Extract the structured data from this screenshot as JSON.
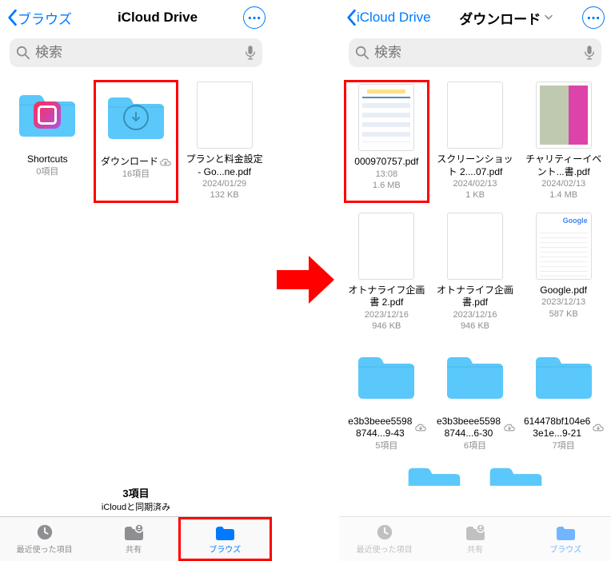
{
  "left": {
    "back_label": "ブラウズ",
    "title": "iCloud Drive",
    "search_placeholder": "検索",
    "items": [
      {
        "name": "Shortcuts",
        "meta1": "0項目",
        "meta2": "",
        "type": "shortcuts"
      },
      {
        "name": "ダウンロード",
        "meta1": "16項目",
        "meta2": "",
        "type": "download",
        "cloud": true,
        "highlight": true
      },
      {
        "name": "プランと料金設定 - Go...ne.pdf",
        "meta1": "2024/01/29",
        "meta2": "132 KB",
        "type": "doc"
      }
    ],
    "footer_count": "3項目",
    "footer_sync": "iCloudと同期済み"
  },
  "right": {
    "back_label": "iCloud Drive",
    "title": "ダウンロード",
    "search_placeholder": "検索",
    "items": [
      {
        "name": "000970757.pdf",
        "meta1": "13:08",
        "meta2": "1.6 MB",
        "type": "table",
        "highlight": true
      },
      {
        "name": "スクリーンショット 2....07.pdf",
        "meta1": "2024/02/13",
        "meta2": "1 KB",
        "type": "blank"
      },
      {
        "name": "チャリティーイベント...書.pdf",
        "meta1": "2024/02/13",
        "meta2": "1.4 MB",
        "type": "charity"
      },
      {
        "name": "オトナライフ企画書 2.pdf",
        "meta1": "2023/12/16",
        "meta2": "946 KB",
        "type": "blank"
      },
      {
        "name": "オトナライフ企画書.pdf",
        "meta1": "2023/12/16",
        "meta2": "946 KB",
        "type": "blank"
      },
      {
        "name": "Google.pdf",
        "meta1": "2023/12/13",
        "meta2": "587 KB",
        "type": "google"
      },
      {
        "name": "e3b3beee55988744...9-43",
        "meta1": "5項目",
        "meta2": "",
        "type": "folder",
        "cloud": true
      },
      {
        "name": "e3b3beee55988744...6-30",
        "meta1": "6項目",
        "meta2": "",
        "type": "folder",
        "cloud": true
      },
      {
        "name": "614478bf104e63e1e...9-21",
        "meta1": "7項目",
        "meta2": "",
        "type": "folder",
        "cloud": true
      }
    ]
  },
  "tabs": {
    "recents": "最近使った項目",
    "shared": "共有",
    "browse": "ブラウズ"
  }
}
